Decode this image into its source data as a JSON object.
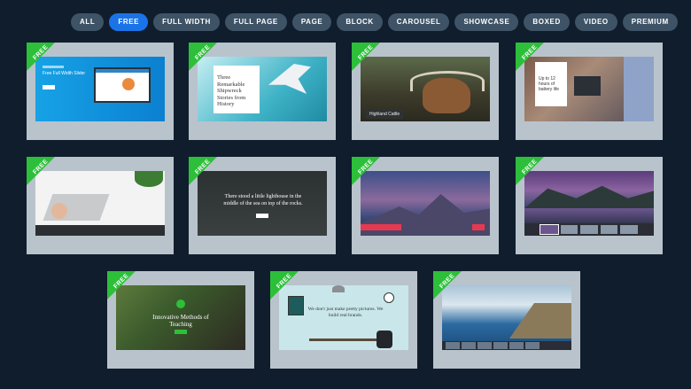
{
  "filters": [
    {
      "label": "ALL",
      "active": false
    },
    {
      "label": "FREE",
      "active": true
    },
    {
      "label": "FULL WIDTH",
      "active": false
    },
    {
      "label": "FULL PAGE",
      "active": false
    },
    {
      "label": "PAGE",
      "active": false
    },
    {
      "label": "BLOCK",
      "active": false
    },
    {
      "label": "CAROUSEL",
      "active": false
    },
    {
      "label": "SHOWCASE",
      "active": false
    },
    {
      "label": "BOXED",
      "active": false
    },
    {
      "label": "VIDEO",
      "active": false
    },
    {
      "label": "PREMIUM",
      "active": false
    }
  ],
  "badge": "FREE",
  "cards": [
    {
      "heading": "Free Full Width Slider"
    },
    {
      "heading": "Three Remarkable Shipwreck Stories from History"
    },
    {
      "caption": "Highland Cattle"
    },
    {
      "heading": "Up to 12 hours of battery life"
    },
    {},
    {
      "heading": "There stood a little lighthouse in the middle of the sea on top of the rocks."
    },
    {},
    {},
    {
      "heading": "Innovative Methods of Teaching"
    },
    {
      "heading": "We don't just make pretty pictures. We build real brands."
    },
    {}
  ],
  "colors": {
    "background": "#0f1d2d",
    "pill": "#3e5366",
    "pill_active": "#1b73e8",
    "card": "#b9c3cc",
    "badge": "#2dbf3a"
  }
}
